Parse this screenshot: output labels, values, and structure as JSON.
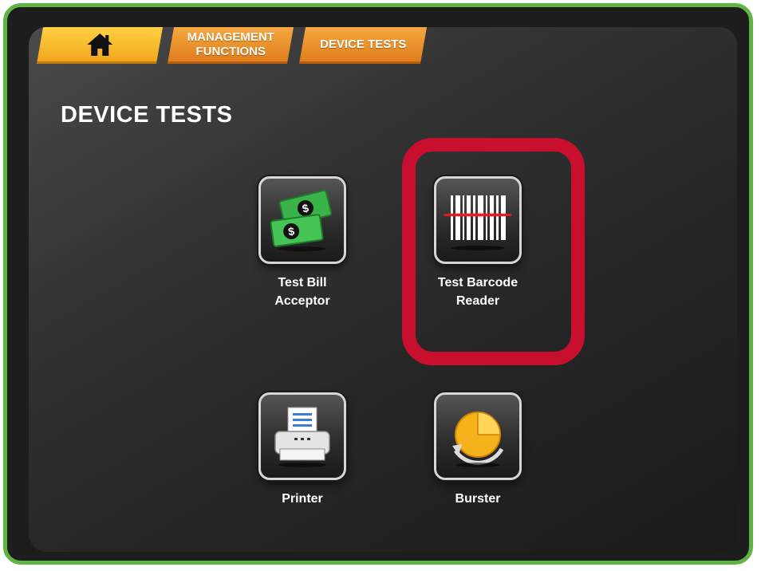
{
  "tabs": {
    "home_icon": "home-icon",
    "management_label": "MANAGEMENT FUNCTIONS",
    "device_tests_label": "DEVICE TESTS"
  },
  "page": {
    "title": "DEVICE TESTS"
  },
  "tiles": [
    {
      "label_line1": "Test Bill",
      "label_line2": "Acceptor",
      "icon": "money-icon"
    },
    {
      "label_line1": "Test Barcode",
      "label_line2": "Reader",
      "icon": "barcode-icon",
      "highlighted": true
    },
    {
      "label_line1": "Printer",
      "label_line2": "",
      "icon": "printer-icon"
    },
    {
      "label_line1": "Burster",
      "label_line2": "",
      "icon": "burster-icon"
    }
  ],
  "colors": {
    "frame": "#5fb443",
    "highlight": "#c8102e",
    "tab_orange": "#e8891f",
    "tab_home": "#f7b62a"
  }
}
